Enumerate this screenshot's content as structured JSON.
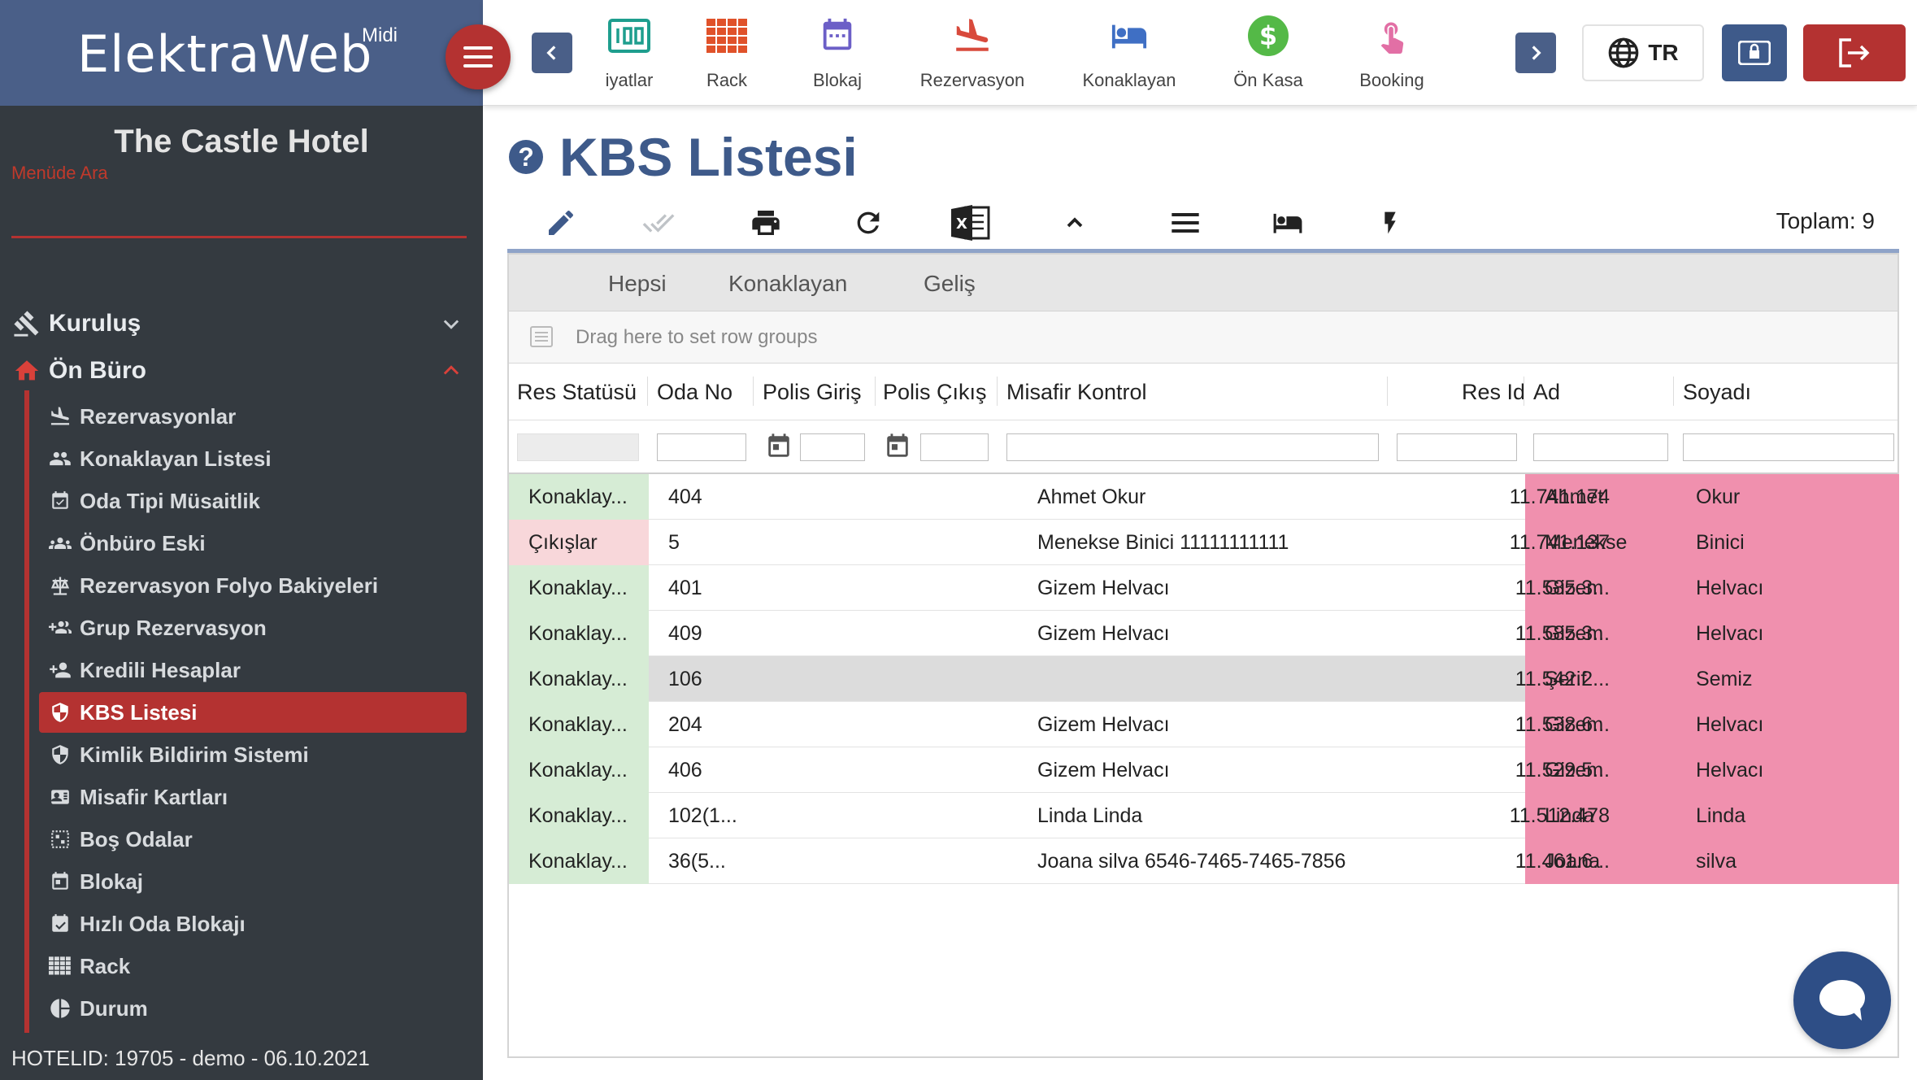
{
  "brand": {
    "name": "ElektraWeb",
    "edition": "Midi"
  },
  "sidebar": {
    "hotel_name": "The Castle Hotel",
    "search_placeholder": "Menüde Ara",
    "groups": [
      {
        "label": "Kuruluş",
        "icon": "gavel-icon",
        "expanded": false
      },
      {
        "label": "Ön Büro",
        "icon": "home-icon",
        "expanded": true
      }
    ],
    "items": [
      {
        "label": "Rezervasyonlar",
        "icon": "plane-landing-icon"
      },
      {
        "label": "Konaklayan Listesi",
        "icon": "people-icon"
      },
      {
        "label": "Oda Tipi Müsaitlik",
        "icon": "calendar-check-icon"
      },
      {
        "label": "Önbüro Eski",
        "icon": "group-icon"
      },
      {
        "label": "Rezervasyon Folyo Bakiyeleri",
        "icon": "balance-scale-icon"
      },
      {
        "label": "Grup Rezervasyon",
        "icon": "group-add-icon"
      },
      {
        "label": "Kredili Hesaplar",
        "icon": "person-add-icon"
      },
      {
        "label": "KBS Listesi",
        "icon": "shield-icon",
        "active": true
      },
      {
        "label": "Kimlik Bildirim Sistemi",
        "icon": "shield-icon"
      },
      {
        "label": "Misafir Kartları",
        "icon": "id-card-icon"
      },
      {
        "label": "Boş Odalar",
        "icon": "empty-grid-icon"
      },
      {
        "label": "Blokaj",
        "icon": "calendar-icon"
      },
      {
        "label": "Hızlı Oda Blokajı",
        "icon": "calendar-check-icon"
      },
      {
        "label": "Rack",
        "icon": "grid-icon"
      },
      {
        "label": "Durum",
        "icon": "pie-chart-icon"
      }
    ],
    "footer": "HOTELID: 19705 - demo - 06.10.2021"
  },
  "topbar": {
    "items": [
      {
        "label": "iyatlar",
        "icon": "prices-icon",
        "color": "#1e9e8e"
      },
      {
        "label": "Rack",
        "icon": "rack-grid-icon",
        "color": "#e0522a"
      },
      {
        "label": "Blokaj",
        "icon": "calendar-icon",
        "color": "#6c5fc7"
      },
      {
        "label": "Rezervasyon",
        "icon": "plane-landing-icon",
        "color": "#d84a3c"
      },
      {
        "label": "Konaklayan",
        "icon": "bed-icon",
        "color": "#3f6fc4"
      },
      {
        "label": "Ön Kasa",
        "icon": "dollar-icon",
        "color": "#54b947"
      },
      {
        "label": "Booking",
        "icon": "hand-pointer-icon",
        "color": "#e26fa5"
      }
    ],
    "language": "TR"
  },
  "page": {
    "title": "KBS Listesi",
    "total_label": "Toplam: 9"
  },
  "grid": {
    "tabs": [
      "Hepsi",
      "Konaklayan",
      "Geliş"
    ],
    "group_panel_text": "Drag here to set row groups",
    "columns": [
      "Res Statüsü",
      "Oda No",
      "Polis Giriş",
      "Polis Çıkış",
      "Misafir Kontrol",
      "Res Id",
      "Ad",
      "Soyadı"
    ],
    "rows": [
      {
        "status": "Konaklay...",
        "status_type": "in",
        "room": "404",
        "guest": "Ahmet Okur",
        "res_id": "11.741.174",
        "name": "Ahmet",
        "surname": "Okur"
      },
      {
        "status": "Çıkışlar",
        "status_type": "out",
        "room": "5",
        "guest": "Menekse Binici 11111111111",
        "res_id": "11.741.137",
        "name": "Menekse",
        "surname": "Binici"
      },
      {
        "status": "Konaklay...",
        "status_type": "in",
        "room": "401",
        "guest": "Gizem Helvacı",
        "res_id": "11.585.3...",
        "name": "Gizem",
        "surname": "Helvacı"
      },
      {
        "status": "Konaklay...",
        "status_type": "in",
        "room": "409",
        "guest": "Gizem Helvacı",
        "res_id": "11.585.3...",
        "name": "Gizem",
        "surname": "Helvacı"
      },
      {
        "status": "Konaklay...",
        "status_type": "in",
        "room": "106",
        "guest": "",
        "res_id": "11.542.2...",
        "name": "Şerif",
        "surname": "Semiz",
        "selected": true
      },
      {
        "status": "Konaklay...",
        "status_type": "in",
        "room": "204",
        "guest": "Gizem Helvacı",
        "res_id": "11.538.6...",
        "name": "Gizem",
        "surname": "Helvacı"
      },
      {
        "status": "Konaklay...",
        "status_type": "in",
        "room": "406",
        "guest": "Gizem Helvacı",
        "res_id": "11.529.5...",
        "name": "Gizem",
        "surname": "Helvacı"
      },
      {
        "status": "Konaklay...",
        "status_type": "in",
        "room": "102(1...",
        "guest": "Linda Linda",
        "res_id": "11.512.478",
        "name": "Linda",
        "surname": "Linda"
      },
      {
        "status": "Konaklay...",
        "status_type": "in",
        "room": "36(5...",
        "guest": "Joana silva 6546-7465-7465-7856",
        "res_id": "11.461.6...",
        "name": "Joana",
        "surname": "silva"
      }
    ]
  },
  "colors": {
    "brand_blue": "#4a5f88",
    "accent_red": "#b43231",
    "sidebar_bg": "#343a40",
    "status_in": "#d6ecd5",
    "status_out": "#f8d7da",
    "name_highlight": "#f090ae"
  }
}
